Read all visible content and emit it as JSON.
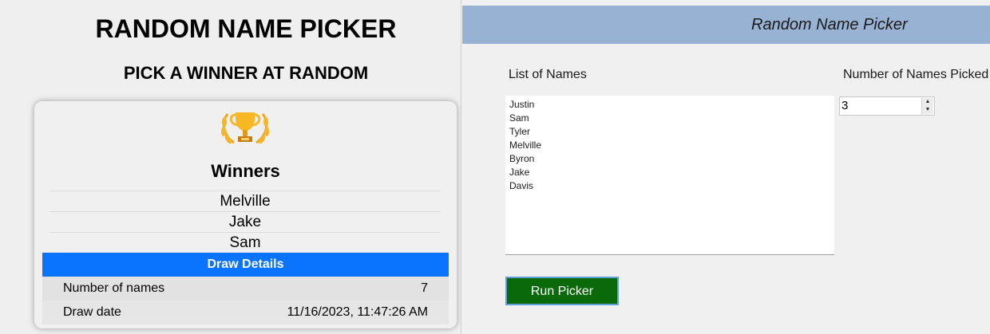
{
  "left": {
    "title": "RANDOM NAME PICKER",
    "subtitle": "PICK A WINNER AT RANDOM",
    "trophy_icon": "trophy-icon",
    "winners_title": "Winners",
    "winners": [
      "Melville",
      "Jake",
      "Sam"
    ],
    "details_title": "Draw Details",
    "details": [
      {
        "key": "Number of names",
        "value": "7"
      },
      {
        "key": "Draw date",
        "value": "11/16/2023, 11:47:26 AM"
      }
    ],
    "accent_color": "#0a74ff"
  },
  "right": {
    "window_title": "Random Name Picker",
    "list_label": "List of Names",
    "names": [
      "Justin",
      "Sam",
      "Tyler",
      "Melville",
      "Byron",
      "Jake",
      "Davis"
    ],
    "count_label": "Number of Names Picked",
    "count_value": "3",
    "run_button": "Run Picker",
    "titlebar_color": "#97b2d2",
    "button_color": "#0a6a0a"
  }
}
